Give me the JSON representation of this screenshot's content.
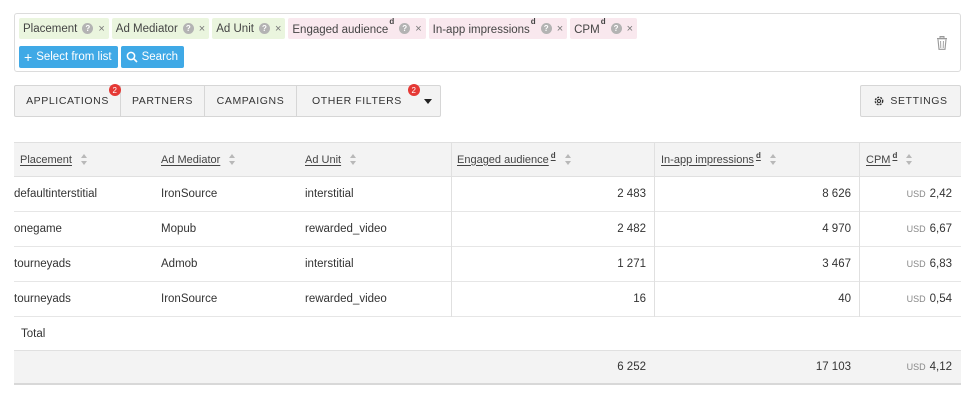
{
  "filters": {
    "chips": [
      {
        "label": "Placement",
        "sup": "",
        "color": "green"
      },
      {
        "label": "Ad Mediator",
        "sup": "",
        "color": "green"
      },
      {
        "label": "Ad Unit",
        "sup": "",
        "color": "green"
      },
      {
        "label": "Engaged audience",
        "sup": "d",
        "color": "pink"
      },
      {
        "label": "In-app impressions",
        "sup": "d",
        "color": "pink"
      },
      {
        "label": "CPM",
        "sup": "d",
        "color": "pink"
      }
    ],
    "help_glyph": "?",
    "remove_glyph": "×",
    "select_label": "Select from list",
    "search_label": "Search"
  },
  "tabs": [
    {
      "label": "APPLICATIONS",
      "badge": "2"
    },
    {
      "label": "PARTNERS",
      "badge": ""
    },
    {
      "label": "CAMPAIGNS",
      "badge": ""
    },
    {
      "label": "OTHER FILTERS",
      "badge": "2"
    }
  ],
  "settings_label": "SETTINGS",
  "table": {
    "columns": [
      {
        "label": "Placement",
        "sup": ""
      },
      {
        "label": "Ad Mediator",
        "sup": ""
      },
      {
        "label": "Ad Unit",
        "sup": ""
      },
      {
        "label": "Engaged audience",
        "sup": "d"
      },
      {
        "label": "In-app impressions",
        "sup": "d"
      },
      {
        "label": "CPM",
        "sup": "d"
      }
    ],
    "currency": "USD",
    "rows": [
      {
        "placement": "defaultinterstitial",
        "mediator": "IronSource",
        "unit": "interstitial",
        "engaged": "2 483",
        "impressions": "8 626",
        "cpm": "2,42"
      },
      {
        "placement": "onegame",
        "mediator": "Mopub",
        "unit": "rewarded_video",
        "engaged": "2 482",
        "impressions": "4 970",
        "cpm": "6,67"
      },
      {
        "placement": "tourneyads",
        "mediator": "Admob",
        "unit": "interstitial",
        "engaged": "1 271",
        "impressions": "3 467",
        "cpm": "6,83"
      },
      {
        "placement": "tourneyads",
        "mediator": "IronSource",
        "unit": "rewarded_video",
        "engaged": "16",
        "impressions": "40",
        "cpm": "0,54"
      }
    ],
    "total_label": "Total",
    "totals": {
      "engaged": "6 252",
      "impressions": "17 103",
      "cpm": "4,12"
    }
  }
}
